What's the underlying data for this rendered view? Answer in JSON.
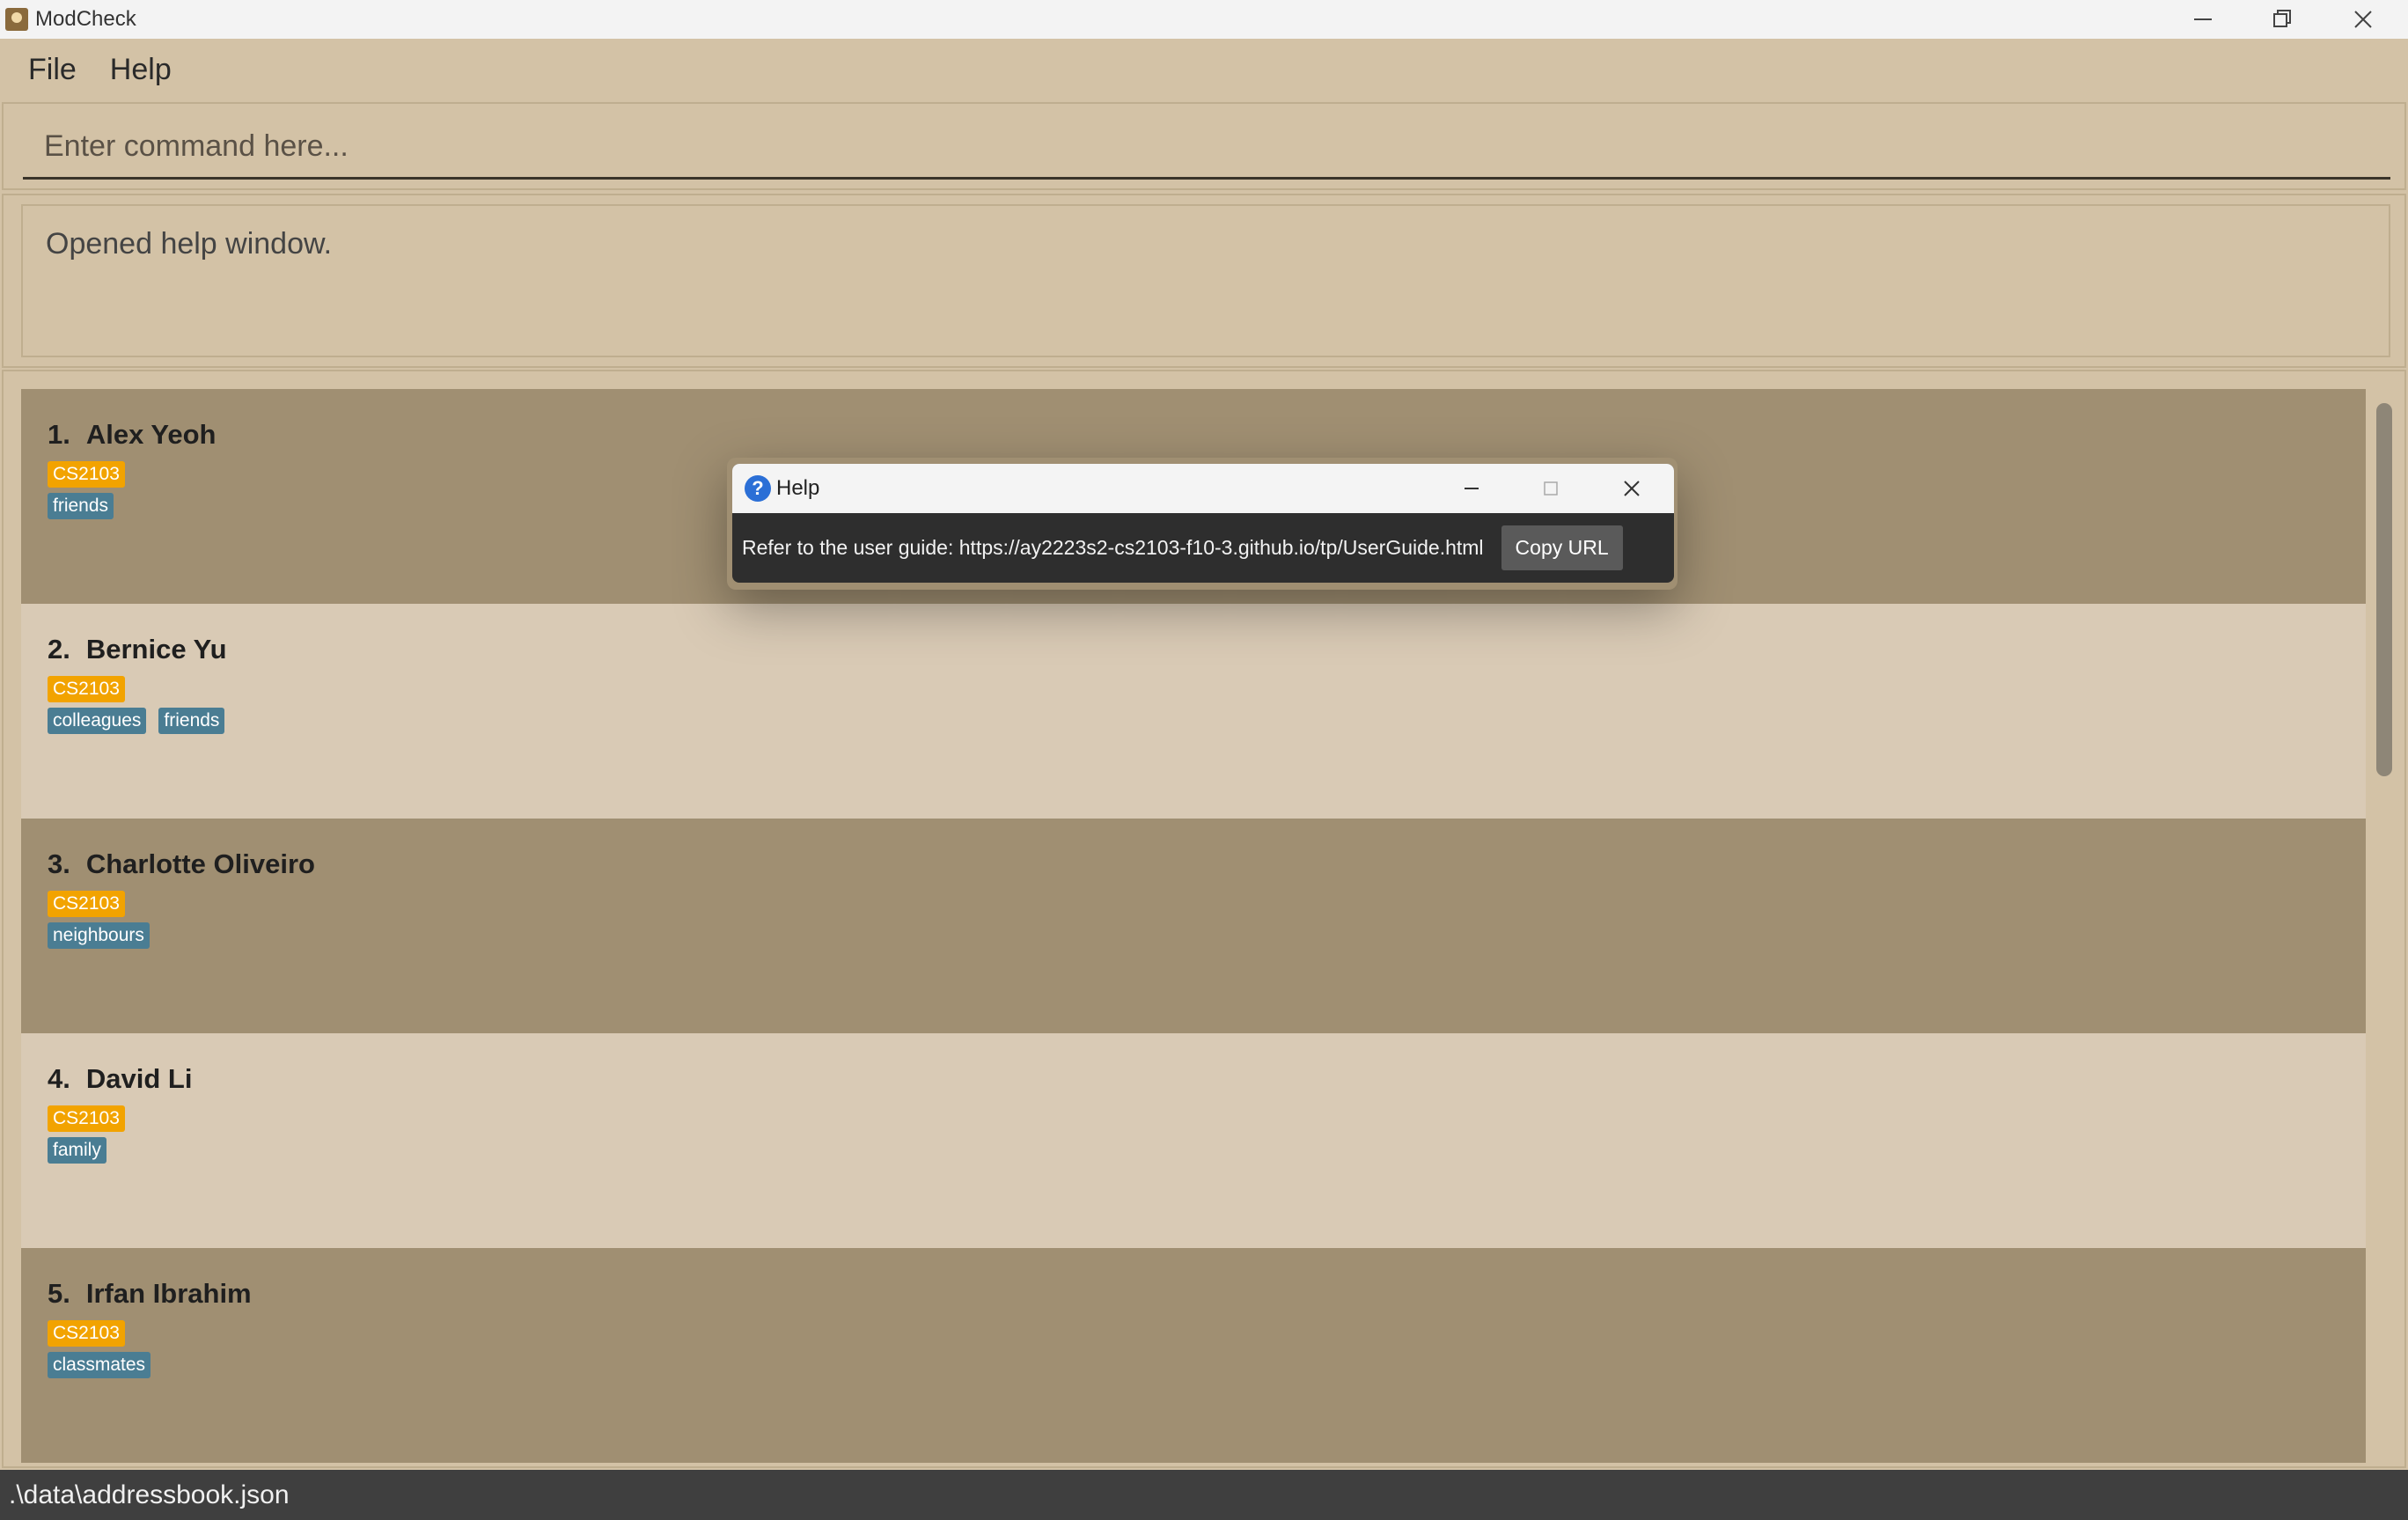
{
  "window": {
    "title": "ModCheck"
  },
  "menu": {
    "items": [
      "File",
      "Help"
    ]
  },
  "command": {
    "placeholder": "Enter command here..."
  },
  "result": {
    "text": "Opened help window."
  },
  "contacts": [
    {
      "index": "1.",
      "name": "Alex Yeoh",
      "modules": [
        "CS2103"
      ],
      "tags": [
        "friends"
      ]
    },
    {
      "index": "2.",
      "name": "Bernice Yu",
      "modules": [
        "CS2103"
      ],
      "tags": [
        "colleagues",
        "friends"
      ]
    },
    {
      "index": "3.",
      "name": "Charlotte Oliveiro",
      "modules": [
        "CS2103"
      ],
      "tags": [
        "neighbours"
      ]
    },
    {
      "index": "4.",
      "name": "David Li",
      "modules": [
        "CS2103"
      ],
      "tags": [
        "family"
      ]
    },
    {
      "index": "5.",
      "name": "Irfan Ibrahim",
      "modules": [
        "CS2103"
      ],
      "tags": [
        "classmates"
      ]
    }
  ],
  "status": {
    "path": ".\\data\\addressbook.json"
  },
  "help_dialog": {
    "title": "Help",
    "message": "Refer to the user guide: https://ay2223s2-cs2103-f10-3.github.io/tp/UserGuide.html",
    "copy_label": "Copy URL"
  },
  "colors": {
    "module_tag": "#f2a300",
    "group_tag": "#4a7d93",
    "card_dark": "#a08f72",
    "card_light": "#d9cab5"
  }
}
